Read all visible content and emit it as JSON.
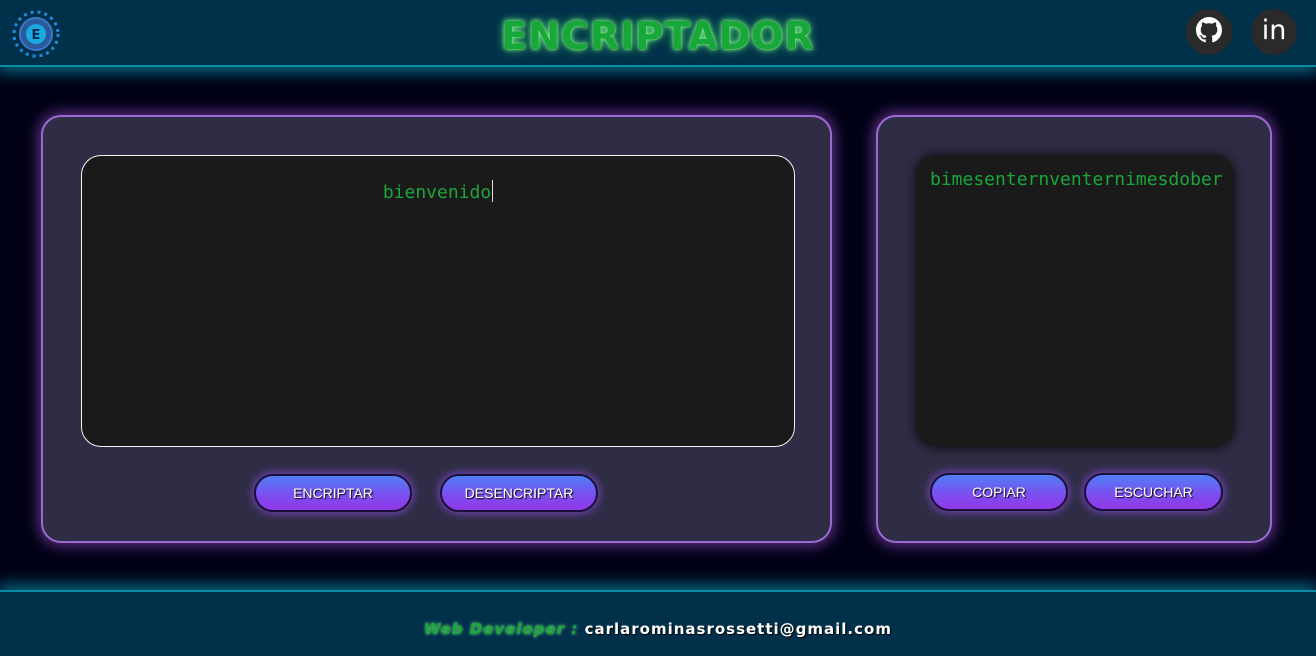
{
  "header": {
    "title": "ENCRIPTADOR",
    "logo_icon": "gear-e-logo-icon",
    "github_icon": "github-icon",
    "linkedin_label": "in"
  },
  "encrypt_panel": {
    "input_value": "bienvenido",
    "encrypt_label": "ENCRIPTAR",
    "decrypt_label": "DESENCRIPTAR"
  },
  "result_panel": {
    "output_value": "bimesenternventernimesdober",
    "copy_label": "COPIAR",
    "listen_label": "ESCUCHAR"
  },
  "footer": {
    "developer_label": "Web Developer :",
    "email": "carlarominasrossetti@gmail.com"
  },
  "colors": {
    "header_bg": "#00304a",
    "page_bg": "#000016",
    "panel_bg": "#2f2d45",
    "accent_green": "#1aa63a",
    "button_gradient_start": "#4f7ff5",
    "button_gradient_end": "#9238e8"
  }
}
